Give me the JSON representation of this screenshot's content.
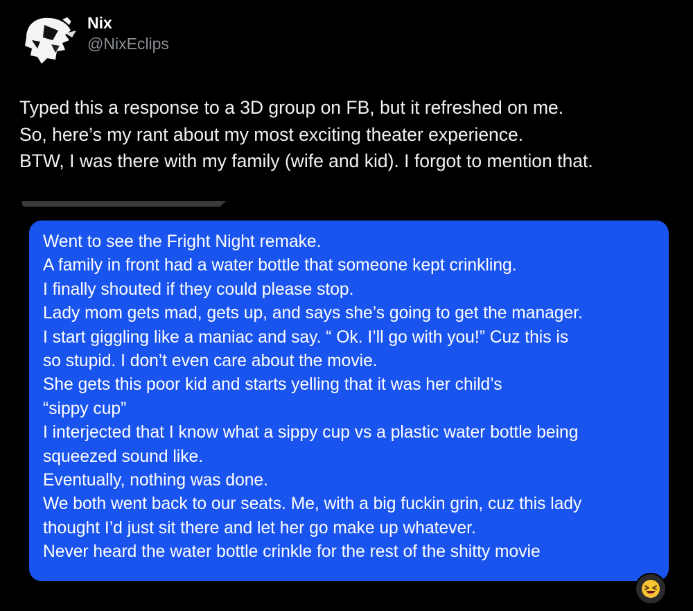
{
  "author": {
    "display_name": "Nix",
    "handle": "@NixEclips",
    "avatar_icon": "skull-avatar-icon"
  },
  "tweet": {
    "lines": [
      "Typed this a response to a 3D group on FB, but it refreshed on me.",
      "So, here’s my rant about my most exciting theater experience.",
      "BTW, I was there with my family (wife and kid). I forgot to mention that."
    ]
  },
  "message": {
    "bubble_color": "#1a54ee",
    "lines": [
      "Went to see the Fright Night remake.",
      "A family in front had a water bottle that someone kept crinkling.",
      "I finally shouted if they could please stop.",
      "Lady mom gets mad, gets up, and says she’s going to get the manager.",
      "I start giggling like a maniac and say. “ Ok. I’ll go with you!” Cuz this is",
      "so stupid. I don’t even care about the movie.",
      "She gets this poor kid and starts yelling that it was her child’s",
      "“sippy cup”",
      "I interjected that I know what a sippy cup vs a plastic water bottle being",
      "squeezed sound like.",
      "Eventually, nothing was done.",
      "We both went back to our seats. Me, with a big fuckin grin, cuz this lady",
      "thought I’d just sit there and let her go make up whatever.",
      "Never heard the water bottle crinkle for the rest of the shitty movie"
    ],
    "reaction_icon": "laughing-face-emoji-icon"
  }
}
